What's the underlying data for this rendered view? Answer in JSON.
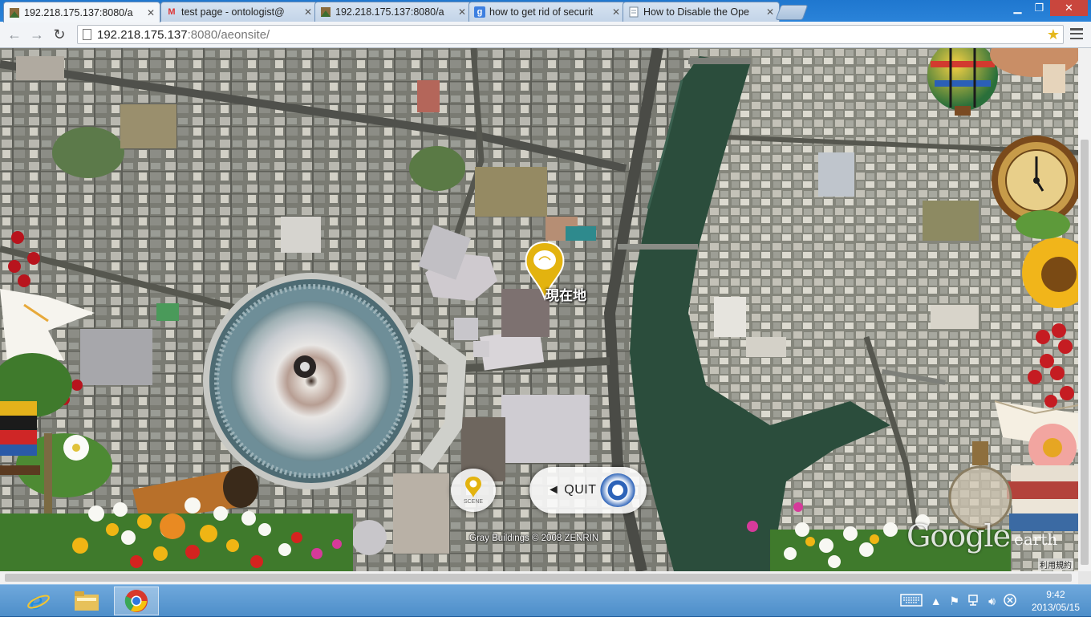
{
  "tabs": [
    {
      "title": "192.218.175.137:8080/a",
      "icon": "earth-favicon-icon",
      "active": true
    },
    {
      "title": "test page - ontologist@",
      "icon": "gmail-icon",
      "active": false
    },
    {
      "title": "192.218.175.137:8080/a",
      "icon": "earth-favicon-icon",
      "active": false
    },
    {
      "title": "how to get rid of securit",
      "icon": "google-icon",
      "active": false
    },
    {
      "title": "How to Disable the Ope",
      "icon": "page-icon",
      "active": false
    }
  ],
  "address": {
    "host": "192.218.175.137",
    "path": ":8080/aeonsite/"
  },
  "map": {
    "pin_label": "現在地",
    "scene_label": "SCENE",
    "quit_label": "◄ QUIT",
    "copyright": "Gray Buildings © 2008 ZENRIN",
    "google_earth": "Google",
    "google_earth_sub": "earth",
    "terms": "利用規約"
  },
  "taskbar": {
    "apps": [
      "internet-explorer-icon",
      "file-explorer-icon",
      "chrome-icon"
    ],
    "time": "9:42",
    "date": "2013/05/15"
  },
  "colors": {
    "chrome_blue": "#2a83d9",
    "pin_yellow": "#e3b30f",
    "river": "#2b4d3c"
  }
}
